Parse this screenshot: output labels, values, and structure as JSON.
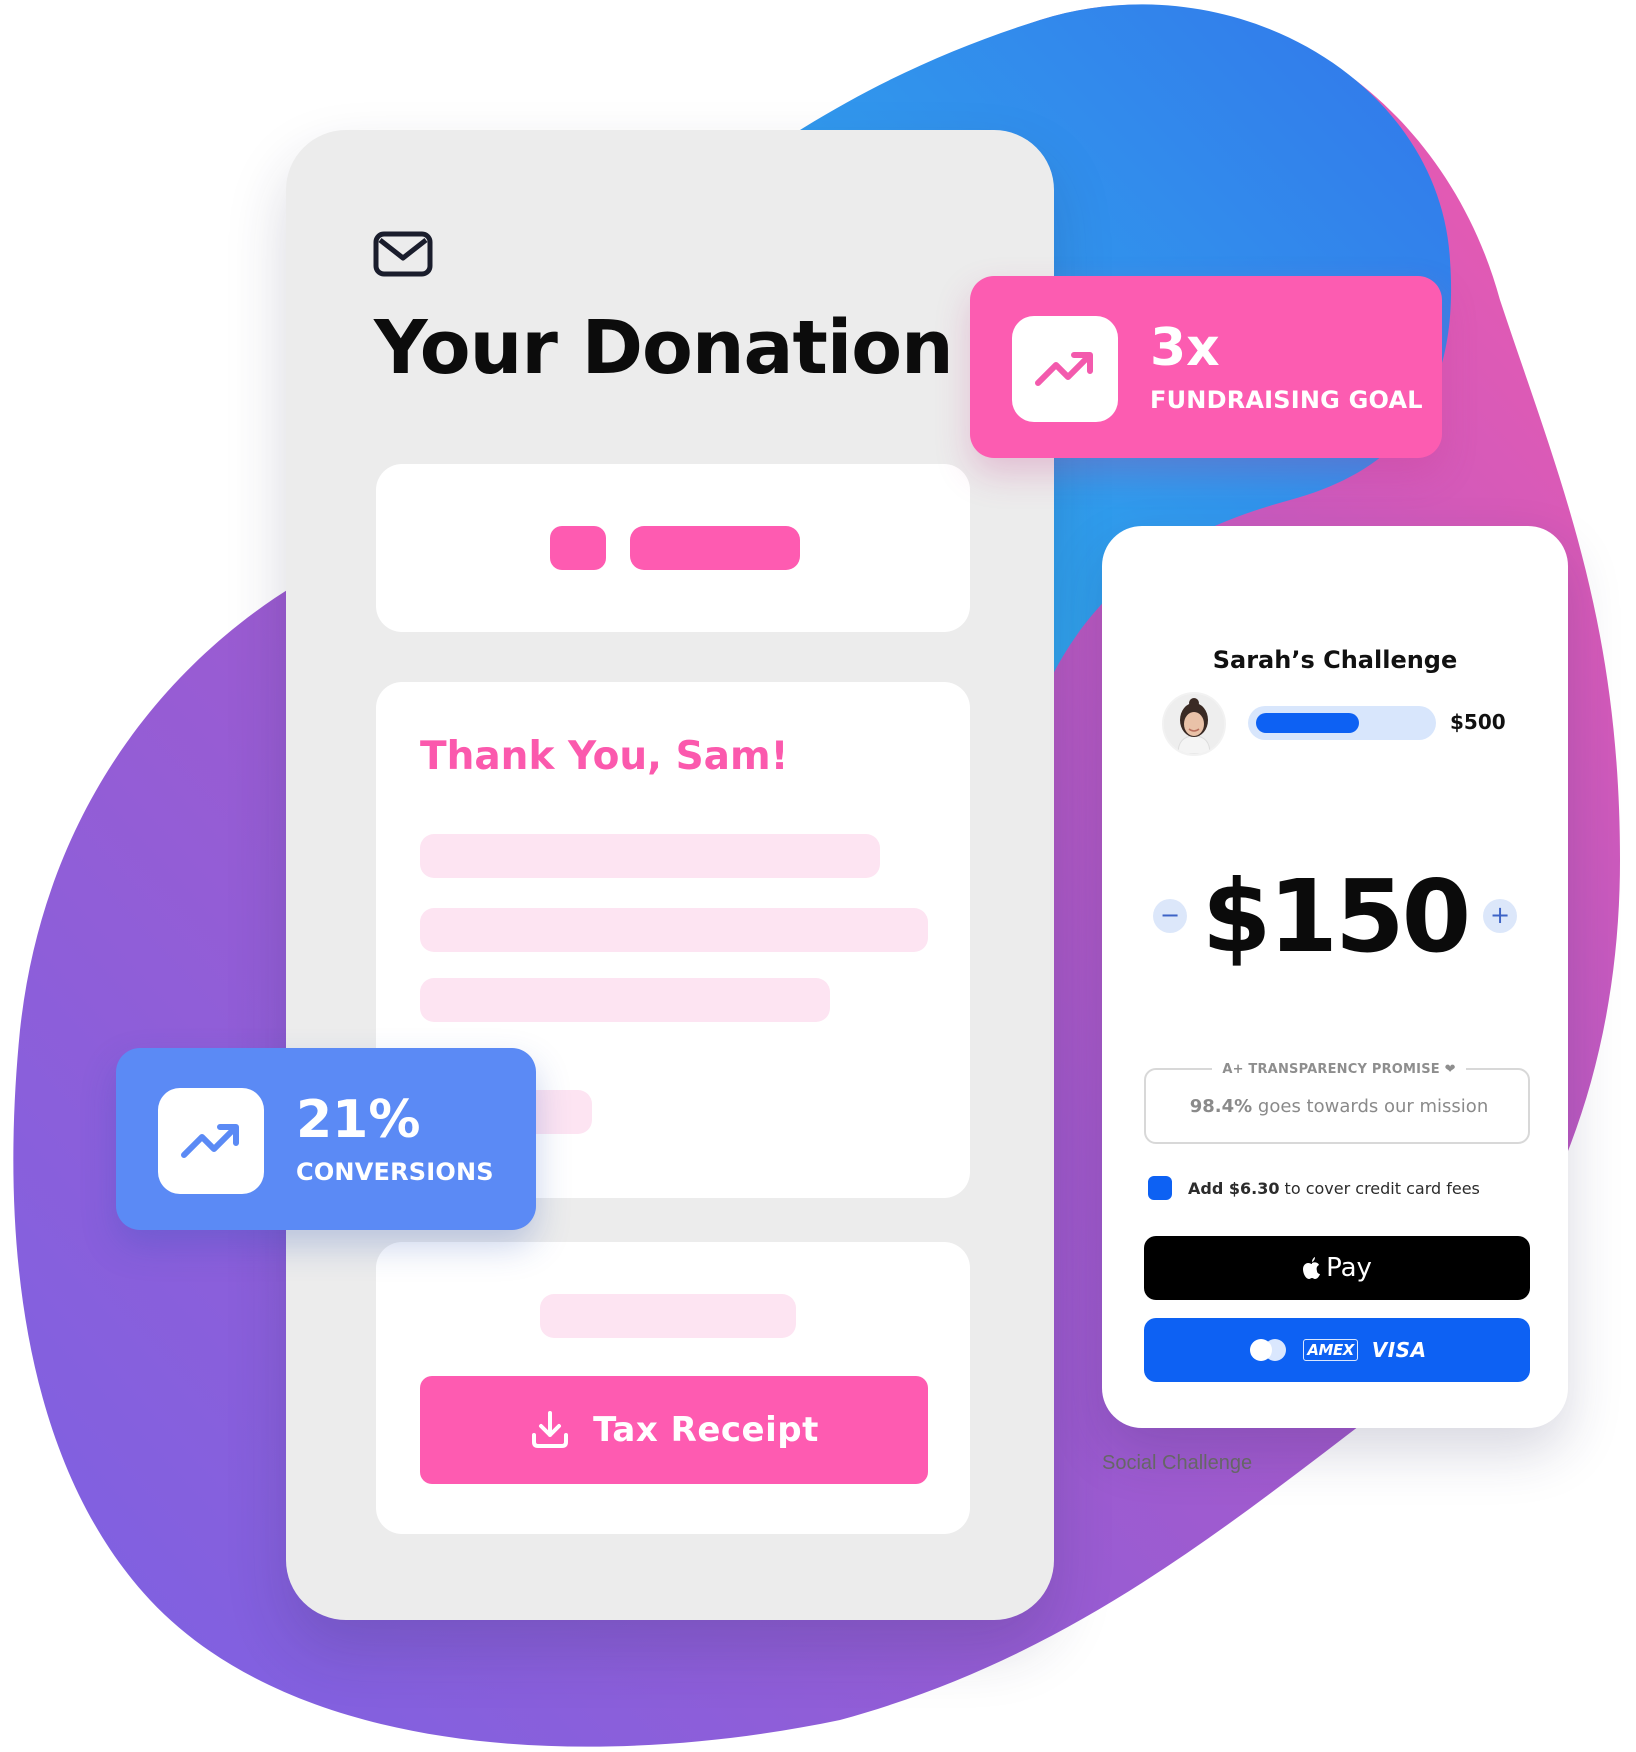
{
  "colors": {
    "pink_accent": "#fe5bb1",
    "blue_accent": "#5b8af5",
    "payment_blue": "#0d61f3",
    "card_gray": "#ececec"
  },
  "donation_card": {
    "icon": "mail-icon",
    "title": "Your Donation",
    "thank_you": "Thank You, Sam!",
    "tax_receipt_label": "Tax Receipt",
    "tax_receipt_icon": "download-icon"
  },
  "stats": {
    "goal_value": "3x",
    "goal_label": "FUNDRAISING GOAL",
    "conversions_value": "21%",
    "conversions_label": "CONVERSIONS",
    "icon": "trending-up-icon"
  },
  "challenge": {
    "title": "Sarah’s Challenge",
    "goal_amount": "$500",
    "progress_fraction": 0.6,
    "amount": "$150",
    "minus_label": "−",
    "plus_label": "+",
    "promise_title": "A+ TRANSPARENCY PROMISE ❤",
    "promise_percent": "98.4%",
    "promise_rest": " goes towards our mission",
    "fee_amount": "Add $6.30",
    "fee_rest": " to cover credit card fees",
    "apple_pay_label": "Pay",
    "card_brands": [
      "AMEX",
      "VISA"
    ],
    "caption": "Social Challenge"
  }
}
